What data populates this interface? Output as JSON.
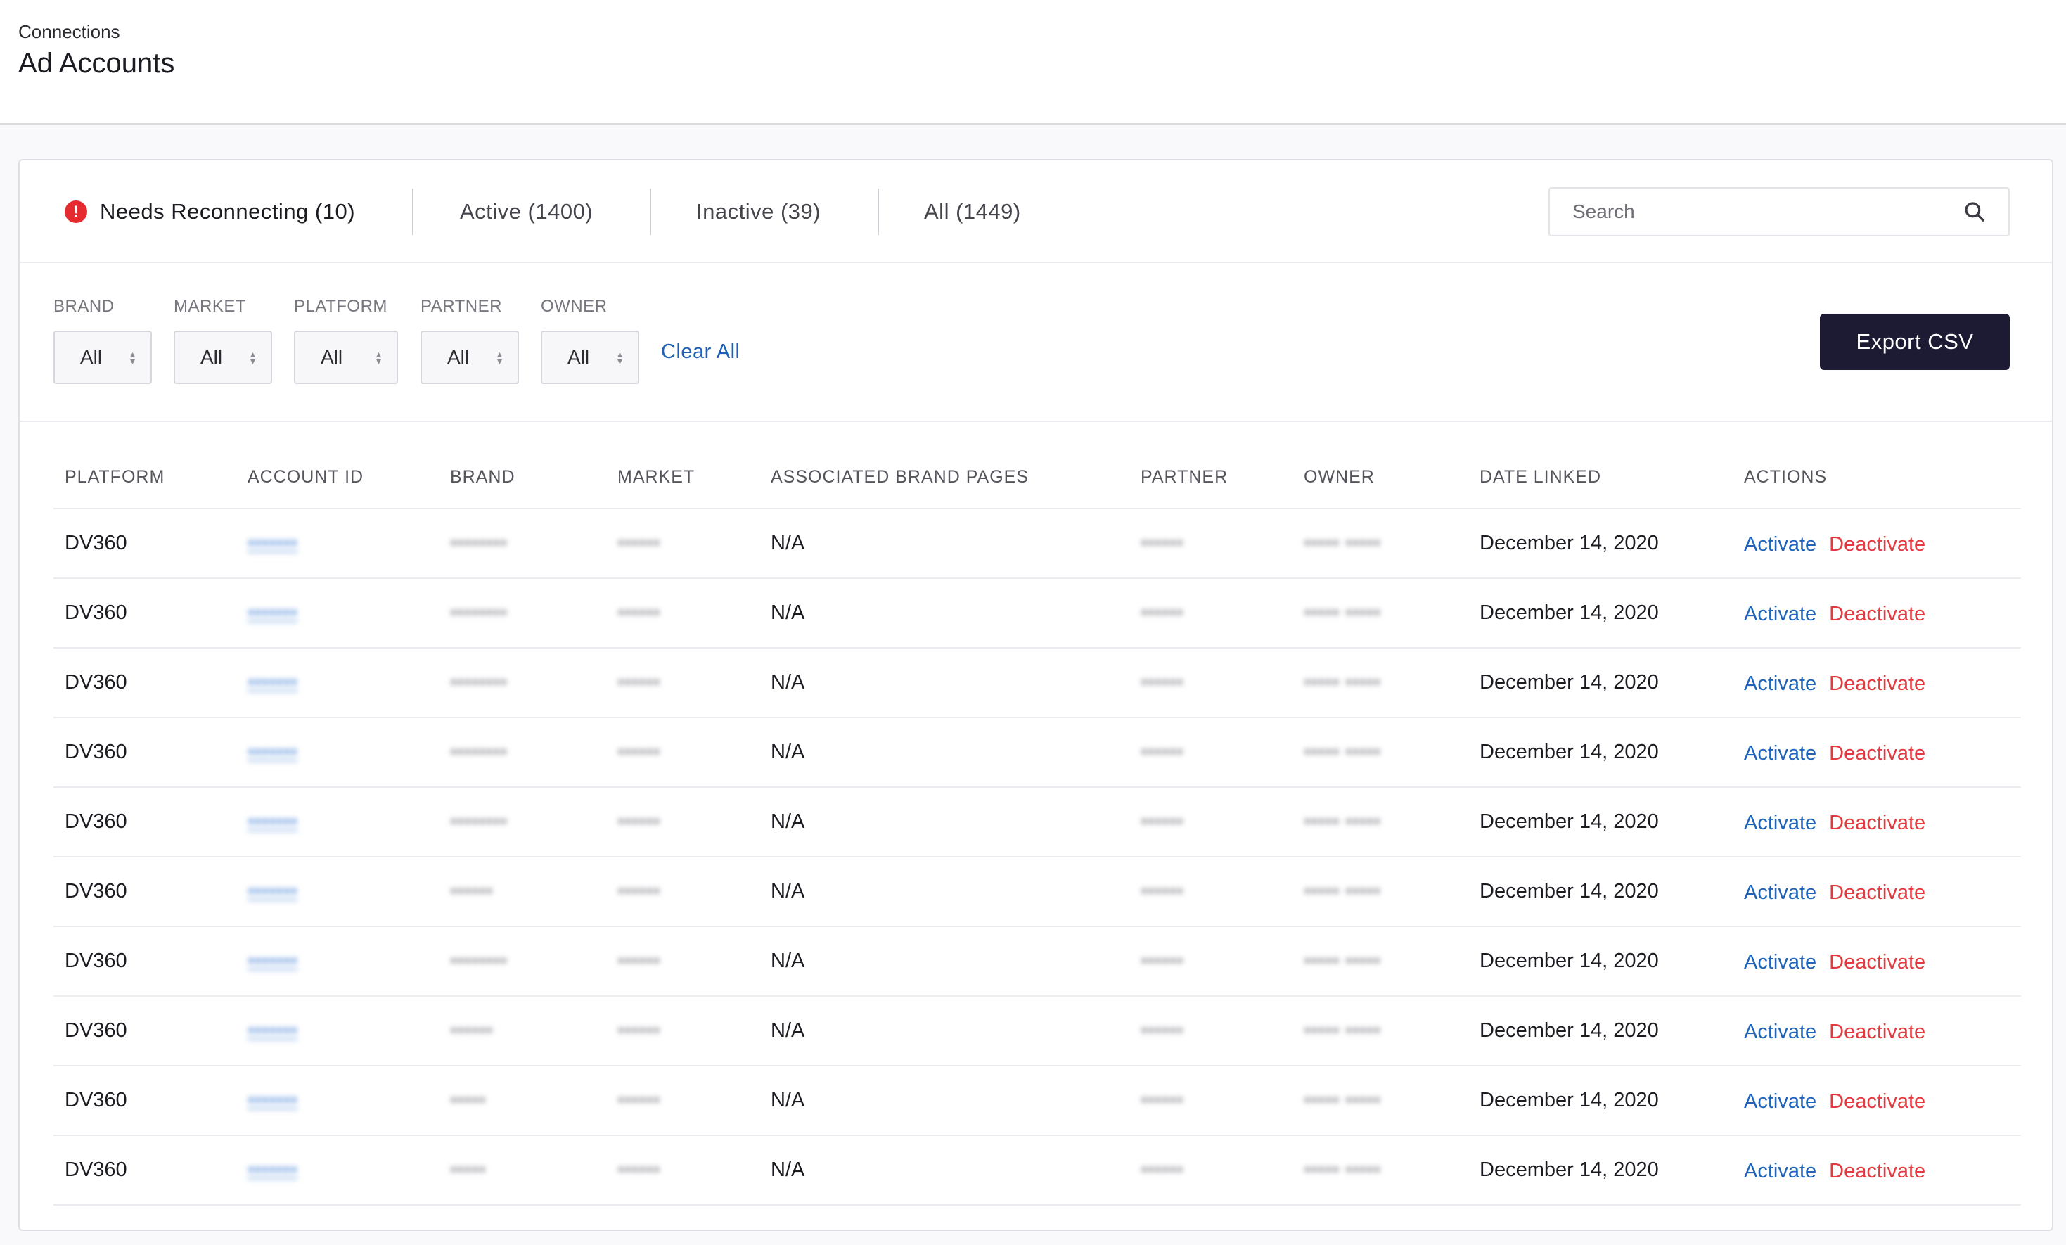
{
  "header": {
    "breadcrumb": "Connections",
    "title": "Ad Accounts"
  },
  "tabs": [
    {
      "label": "Needs Reconnecting (10)",
      "icon": "alert-icon"
    },
    {
      "label": "Active (1400)"
    },
    {
      "label": "Inactive (39)"
    },
    {
      "label": "All (1449)"
    }
  ],
  "search": {
    "placeholder": "Search"
  },
  "filters": [
    {
      "label": "BRAND",
      "value": "All"
    },
    {
      "label": "MARKET",
      "value": "All"
    },
    {
      "label": "PLATFORM",
      "value": "All"
    },
    {
      "label": "PARTNER",
      "value": "All"
    },
    {
      "label": "OWNER",
      "value": "All"
    }
  ],
  "clear_all_label": "Clear All",
  "export_label": "Export CSV",
  "table": {
    "columns": [
      "PLATFORM",
      "ACCOUNT ID",
      "BRAND",
      "MARKET",
      "ASSOCIATED BRAND PAGES",
      "PARTNER",
      "OWNER",
      "DATE LINKED",
      "ACTIONS"
    ],
    "rows": [
      {
        "platform": "DV360",
        "account_id": "•••••••",
        "brand": "••••••••",
        "market": "••••••",
        "pages": "N/A",
        "partner": "••••••",
        "owner": "••••• •••••",
        "date": "December 14, 2020"
      },
      {
        "platform": "DV360",
        "account_id": "•••••••",
        "brand": "••••••••",
        "market": "••••••",
        "pages": "N/A",
        "partner": "••••••",
        "owner": "••••• •••••",
        "date": "December 14, 2020"
      },
      {
        "platform": "DV360",
        "account_id": "•••••••",
        "brand": "••••••••",
        "market": "••••••",
        "pages": "N/A",
        "partner": "••••••",
        "owner": "••••• •••••",
        "date": "December 14, 2020"
      },
      {
        "platform": "DV360",
        "account_id": "•••••••",
        "brand": "••••••••",
        "market": "••••••",
        "pages": "N/A",
        "partner": "••••••",
        "owner": "••••• •••••",
        "date": "December 14, 2020"
      },
      {
        "platform": "DV360",
        "account_id": "•••••••",
        "brand": "••••••••",
        "market": "••••••",
        "pages": "N/A",
        "partner": "••••••",
        "owner": "••••• •••••",
        "date": "December 14, 2020"
      },
      {
        "platform": "DV360",
        "account_id": "•••••••",
        "brand": "••••••",
        "market": "••••••",
        "pages": "N/A",
        "partner": "••••••",
        "owner": "••••• •••••",
        "date": "December 14, 2020"
      },
      {
        "platform": "DV360",
        "account_id": "•••••••",
        "brand": "••••••••",
        "market": "••••••",
        "pages": "N/A",
        "partner": "••••••",
        "owner": "••••• •••••",
        "date": "December 14, 2020"
      },
      {
        "platform": "DV360",
        "account_id": "•••••••",
        "brand": "••••••",
        "market": "••••••",
        "pages": "N/A",
        "partner": "••••••",
        "owner": "••••• •••••",
        "date": "December 14, 2020"
      },
      {
        "platform": "DV360",
        "account_id": "•••••••",
        "brand": "•••••",
        "market": "••••••",
        "pages": "N/A",
        "partner": "••••••",
        "owner": "••••• •••••",
        "date": "December 14, 2020"
      },
      {
        "platform": "DV360",
        "account_id": "•••••••",
        "brand": "•••••",
        "market": "••••••",
        "pages": "N/A",
        "partner": "••••••",
        "owner": "••••• •••••",
        "date": "December 14, 2020"
      }
    ],
    "action_activate": "Activate",
    "action_deactivate": "Deactivate"
  },
  "colors": {
    "accent_blue": "#1f64b8",
    "danger_red": "#e43a3f",
    "export_button": "#1c1b33",
    "alert_icon": "#e62b30"
  }
}
